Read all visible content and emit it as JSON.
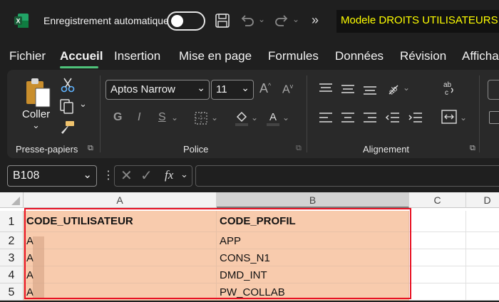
{
  "titlebar": {
    "autosave_label": "Enregistrement automatique",
    "document_title": "Modele DROITS UTILISATEURS...."
  },
  "menu": {
    "tabs": [
      "Fichier",
      "Accueil",
      "Insertion",
      "Mise en page",
      "Formules",
      "Données",
      "Révision",
      "Affichage"
    ],
    "active": "Accueil"
  },
  "ribbon": {
    "clipboard": {
      "paste_label": "Coller",
      "group_label": "Presse-papiers"
    },
    "font": {
      "font_name": "Aptos Narrow",
      "font_size": "11",
      "group_label": "Police",
      "bold": "G",
      "italic": "I",
      "underline": "S"
    },
    "alignment": {
      "group_label": "Alignement"
    }
  },
  "formula_bar": {
    "name_box": "B108",
    "fx": "fx",
    "content": ""
  },
  "grid": {
    "columns": [
      "A",
      "B",
      "C",
      "D"
    ],
    "rows": [
      "1",
      "2",
      "3",
      "4",
      "5"
    ],
    "cells": [
      [
        "CODE_UTILISATEUR",
        "CODE_PROFIL"
      ],
      [
        "A",
        "APP"
      ],
      [
        "A",
        "CONS_N1"
      ],
      [
        "A",
        "DMD_INT"
      ],
      [
        "A",
        "PW_COLLAB"
      ]
    ],
    "highlight_color": "#f8cbad",
    "selection_border_color": "#e81123"
  },
  "colors": {
    "accent_green": "#4ec27a",
    "title_highlight": "#111111",
    "title_text": "#ffff00"
  }
}
